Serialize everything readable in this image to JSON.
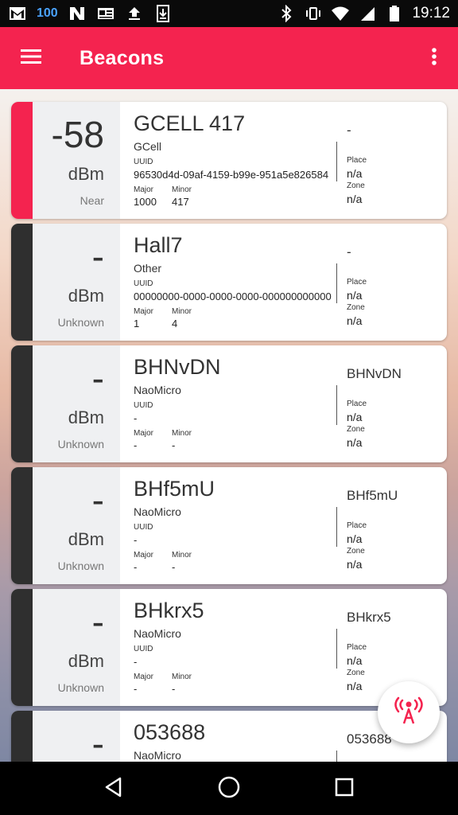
{
  "status_bar": {
    "battery_badge": "100",
    "time": "19:12"
  },
  "app_bar": {
    "title": "Beacons"
  },
  "labels": {
    "uuid": "UUID",
    "major": "Major",
    "minor": "Minor",
    "place": "Place",
    "zone": "Zone",
    "unit": "dBm"
  },
  "colors": {
    "accent": "#f4234f",
    "near_strip": "#f4234f",
    "unknown_strip": "#2f2f2f"
  },
  "beacons": [
    {
      "rssi": "-58",
      "unit": "dBm",
      "proximity": "Near",
      "name": "GCELL 417",
      "type": "GCell",
      "uuid": "96530d4d-09af-4159-b99e-951a5e826584",
      "major": "1000",
      "minor": "417",
      "tag": "-",
      "place": "n/a",
      "zone": "n/a",
      "strip_color": "#f4234f"
    },
    {
      "rssi": "-",
      "unit": "dBm",
      "proximity": "Unknown",
      "name": "Hall7",
      "type": "Other",
      "uuid": "00000000-0000-0000-0000-000000000000",
      "major": "1",
      "minor": "4",
      "tag": "-",
      "place": "n/a",
      "zone": "n/a",
      "strip_color": "#2f2f2f"
    },
    {
      "rssi": "-",
      "unit": "dBm",
      "proximity": "Unknown",
      "name": "BHNvDN",
      "type": "NaoMicro",
      "uuid": "-",
      "major": "-",
      "minor": "-",
      "tag": "BHNvDN",
      "place": "n/a",
      "zone": "n/a",
      "strip_color": "#2f2f2f"
    },
    {
      "rssi": "-",
      "unit": "dBm",
      "proximity": "Unknown",
      "name": "BHf5mU",
      "type": "NaoMicro",
      "uuid": "-",
      "major": "-",
      "minor": "-",
      "tag": "BHf5mU",
      "place": "n/a",
      "zone": "n/a",
      "strip_color": "#2f2f2f"
    },
    {
      "rssi": "-",
      "unit": "dBm",
      "proximity": "Unknown",
      "name": "BHkrx5",
      "type": "NaoMicro",
      "uuid": "-",
      "major": "-",
      "minor": "-",
      "tag": "BHkrx5",
      "place": "n/a",
      "zone": "n/a",
      "strip_color": "#2f2f2f"
    },
    {
      "rssi": "-",
      "unit": "",
      "proximity": "",
      "name": "053688",
      "type": "NaoMicro",
      "uuid": "",
      "major": "",
      "minor": "",
      "tag": "053688",
      "place": "",
      "zone": "",
      "strip_color": "#2f2f2f"
    }
  ],
  "icons": {
    "menu": "hamburger-menu-icon",
    "overflow": "more-vert-icon",
    "fab": "broadcast-tower-icon"
  }
}
